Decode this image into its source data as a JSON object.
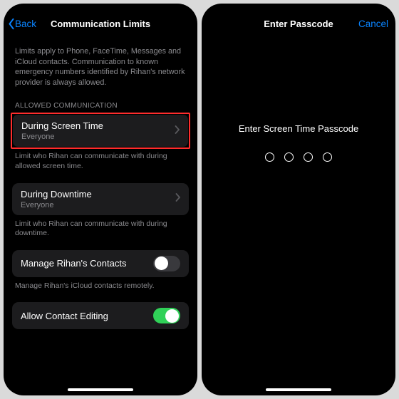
{
  "left": {
    "back": "Back",
    "title": "Communication Limits",
    "intro": "Limits apply to Phone, FaceTime, Messages and iCloud contacts. Communication to known emergency numbers identified by Rihan's network provider is always allowed.",
    "section": "ALLOWED COMMUNICATION",
    "cell1": {
      "title": "During Screen Time",
      "sub": "Everyone"
    },
    "footer1": "Limit who Rihan can communicate with during allowed screen time.",
    "cell2": {
      "title": "During Downtime",
      "sub": "Everyone"
    },
    "footer2": "Limit who Rihan can communicate with during downtime.",
    "cell3": {
      "title": "Manage Rihan's Contacts"
    },
    "footer3": "Manage Rihan's iCloud contacts remotely.",
    "cell4": {
      "title": "Allow Contact Editing"
    }
  },
  "right": {
    "title": "Enter Passcode",
    "cancel": "Cancel",
    "prompt": "Enter Screen Time Passcode"
  }
}
